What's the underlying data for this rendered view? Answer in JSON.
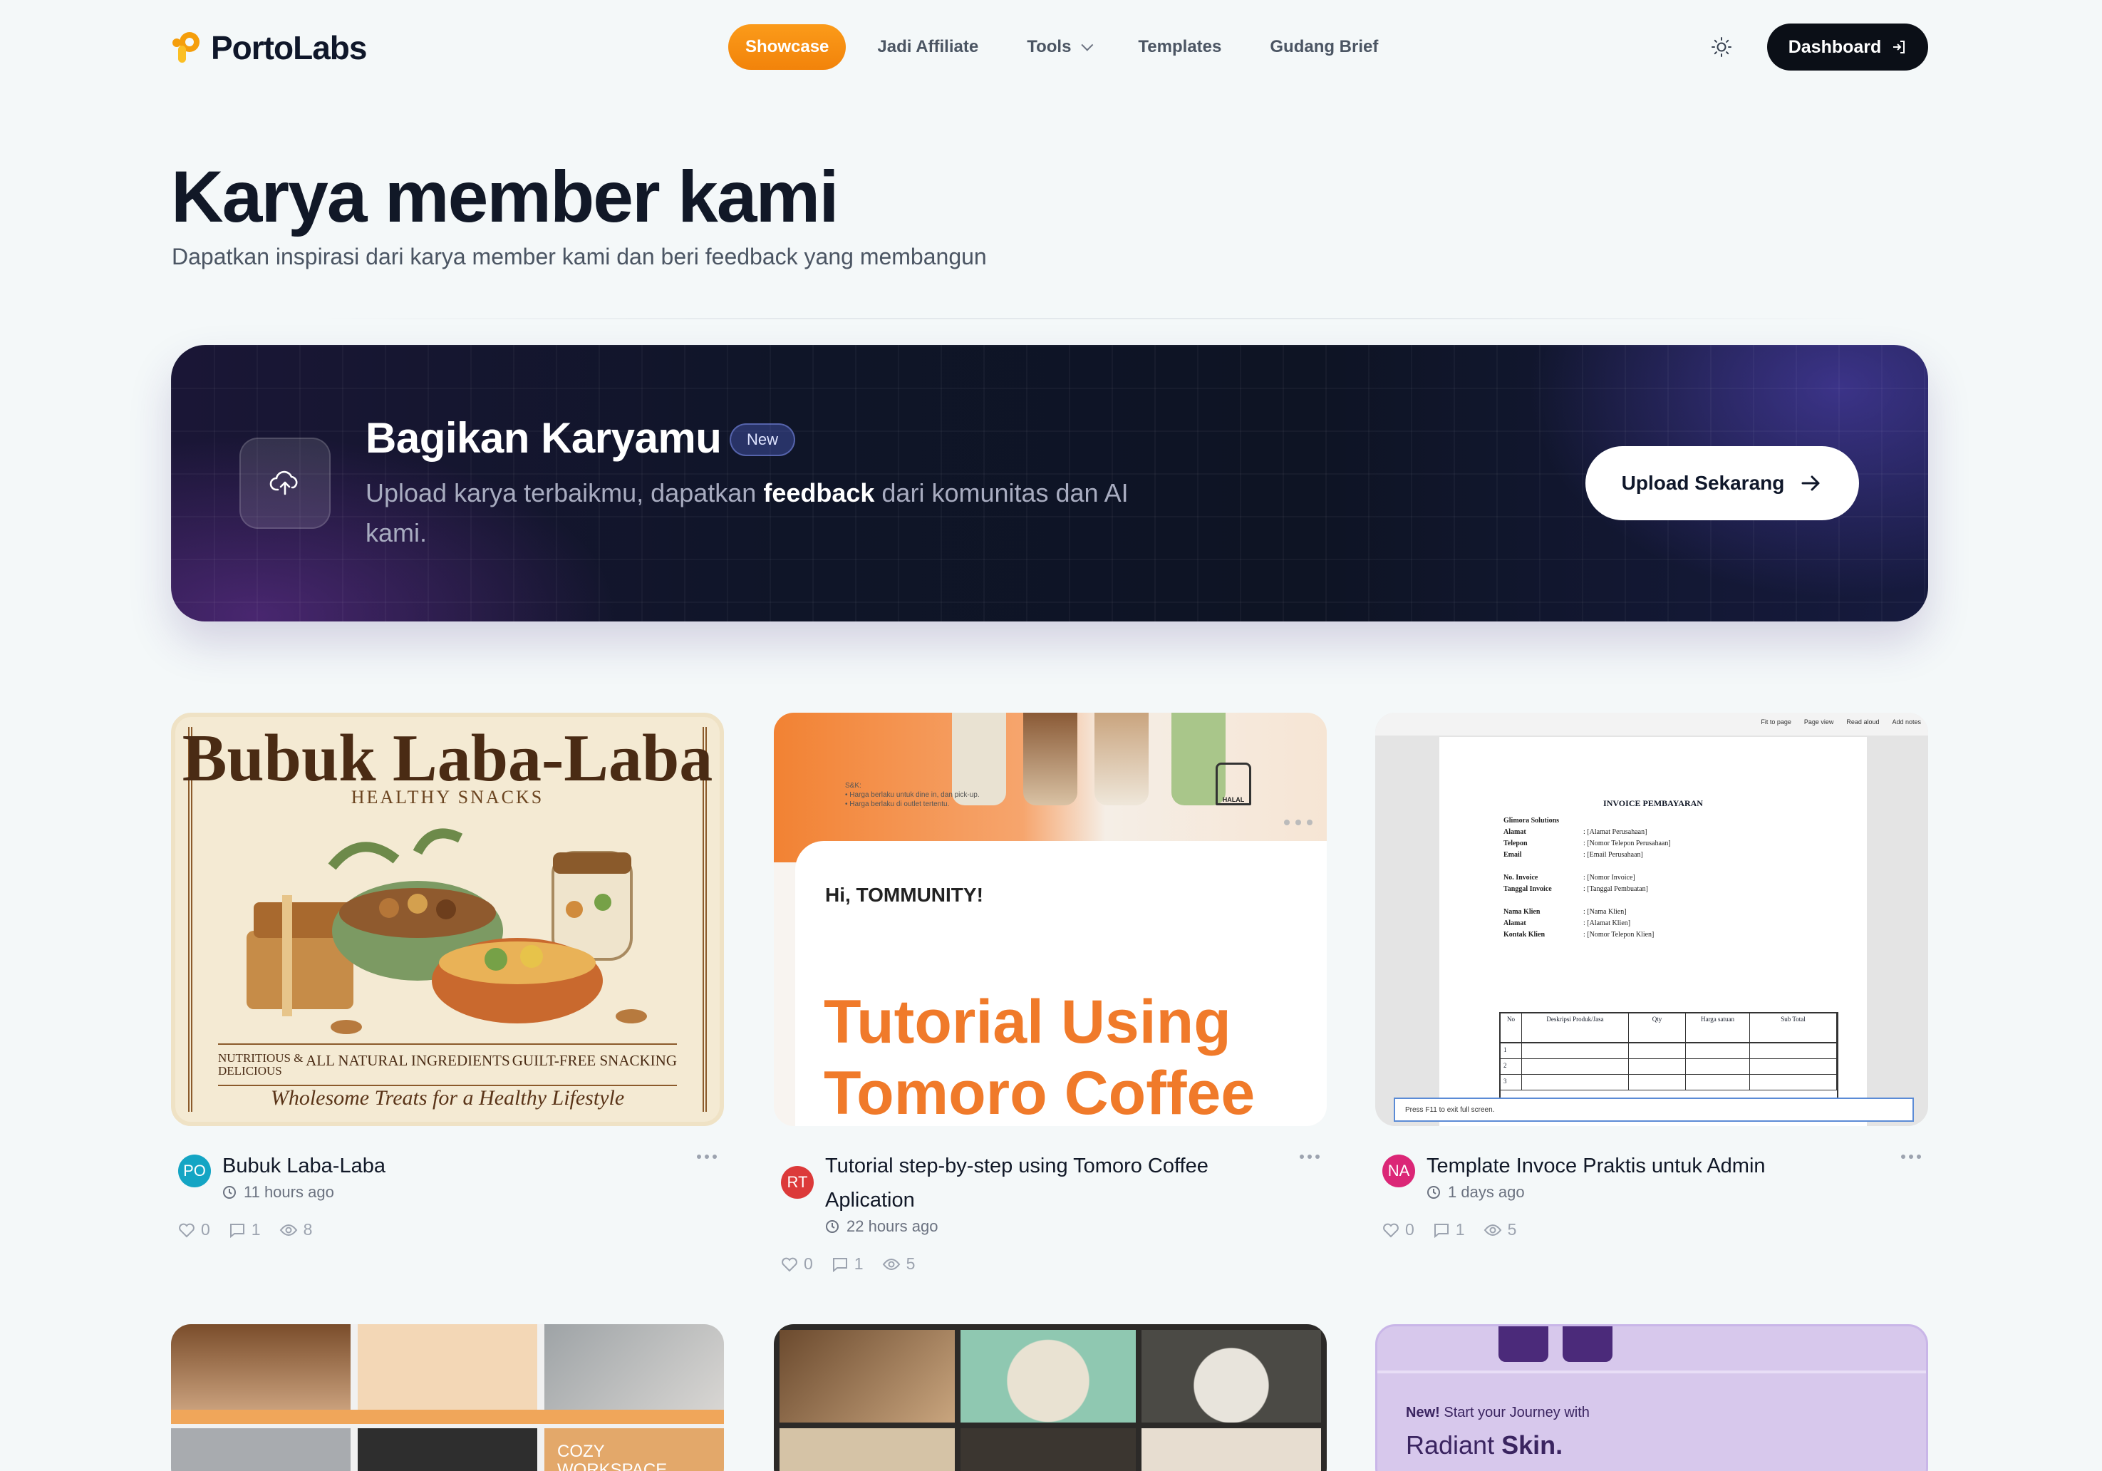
{
  "brand": {
    "name": "PortoLabs"
  },
  "nav": {
    "links": [
      {
        "label": "Showcase",
        "active": true
      },
      {
        "label": "Jadi Affiliate"
      },
      {
        "label": "Tools",
        "has_dropdown": true
      },
      {
        "label": "Templates"
      },
      {
        "label": "Gudang Brief"
      }
    ],
    "dashboard_label": "Dashboard"
  },
  "hero": {
    "title": "Karya member kami",
    "subtitle": "Dapatkan inspirasi dari karya member kami dan beri feedback yang membangun"
  },
  "banner": {
    "title": "Bagikan Karyamu",
    "badge": "New",
    "desc_before": "Upload karya terbaikmu, dapatkan ",
    "desc_bold": "feedback",
    "desc_after": " dari komunitas dan AI kami.",
    "button_label": "Upload Sekarang"
  },
  "cards": [
    {
      "title": "Bubuk Laba-Laba",
      "time": "11 hours ago",
      "avatar": "PO",
      "avatar_color": "#14a5c4",
      "likes": "0",
      "comments": "1",
      "views": "8",
      "thumb": {
        "title": "Bubuk Laba-Laba",
        "subtitle": "HEALTHY SNACKS",
        "tag1": "NUTRITIOUS & DELICIOUS",
        "tag2": "ALL NATURAL INGREDIENTS",
        "tag3": "GUILT-FREE SNACKING",
        "footer": "Wholesome Treats for a Healthy Lifestyle"
      }
    },
    {
      "title": "Tutorial step-by-step using Tomoro Coffee Aplication",
      "time": "22 hours ago",
      "avatar": "RT",
      "avatar_color": "#dc3a3a",
      "likes": "0",
      "comments": "1",
      "views": "5",
      "thumb": {
        "greeting": "Hi, TOMMUNITY!",
        "headline_1": "Tutorial Using",
        "headline_2": "Tomoro Coffee",
        "note_1": "S&K:",
        "note_2": "• Harga berlaku untuk dine in, dan pick-up.",
        "note_3": "• Harga berlaku di outlet tertentu.",
        "halal": "HALAL"
      }
    },
    {
      "title": "Template Invoce Praktis untuk Admin",
      "time": "1 days ago",
      "avatar": "NA",
      "avatar_color": "#db2777",
      "likes": "0",
      "comments": "1",
      "views": "5",
      "thumb": {
        "doc_title": "INVOICE PEMBAYARAN",
        "company": "Glimora Solutions",
        "fields": [
          [
            "Alamat",
            ": [Alamat Perusahaan]"
          ],
          [
            "Telepon",
            ": [Nomor Telepon Perusahaan]"
          ],
          [
            "Email",
            ": [Email Perusahaan]"
          ],
          [
            "",
            ""
          ],
          [
            "No. Invoice",
            ": [Nomor Invoice]"
          ],
          [
            "Tanggal Invoice",
            ": [Tanggal Pembuatan]"
          ],
          [
            "",
            ""
          ],
          [
            "Nama Klien",
            ": [Nama Klien]"
          ],
          [
            "Alamat",
            ": [Alamat Klien]"
          ],
          [
            "Kontak Klien",
            ": [Nomor Telepon Klien]"
          ]
        ],
        "table_headers": [
          "No",
          "Deskripsi Produk/Jasa",
          "Qty",
          "Harga satuan",
          "Sub Total"
        ],
        "row_numbers": [
          "1",
          "2",
          "3"
        ],
        "toolbar_items": [
          "Fit to page",
          "Page view",
          "Read aloud",
          "Add notes"
        ],
        "fullscreen_hint": "Press F11 to exit full screen."
      }
    }
  ],
  "row2": {
    "card4_text": "COZY WORKSPACE",
    "card6_text_new": "New!",
    "card6_text_start": " Start your Journey with",
    "card6_text_radiant": "Radiant ",
    "card6_text_skin": "Skin."
  }
}
